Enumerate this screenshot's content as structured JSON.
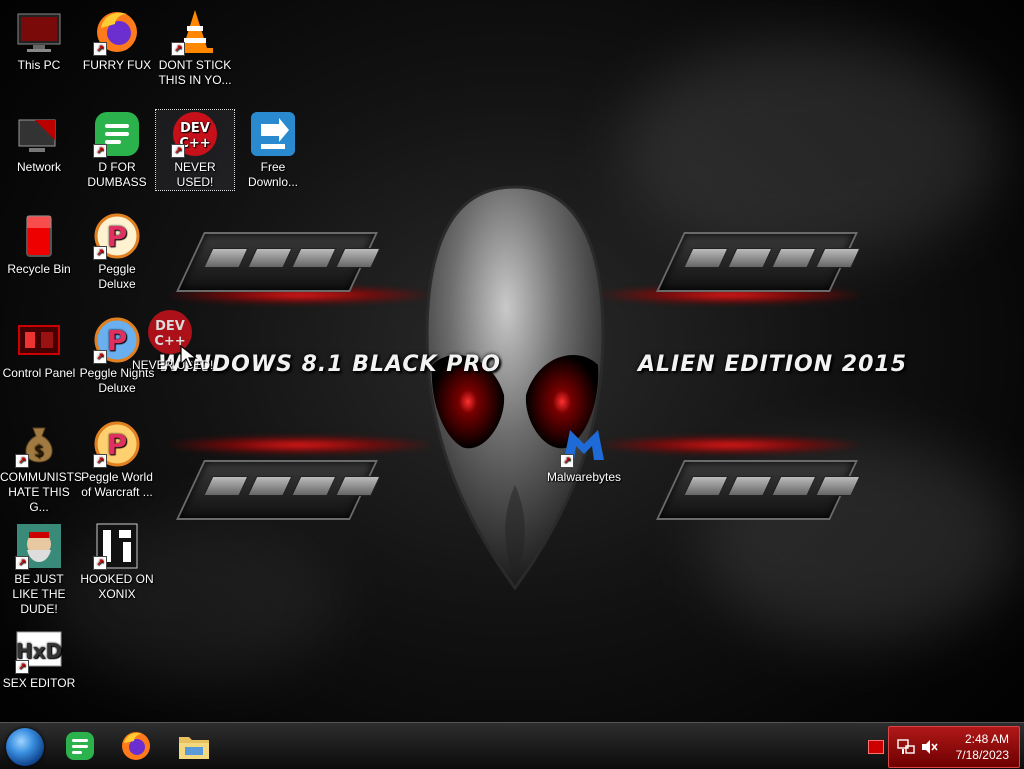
{
  "desktop": {
    "icons": [
      {
        "label": "This PC"
      },
      {
        "label": "FURRY FUX"
      },
      {
        "label": "DONT STICK THIS IN YO..."
      },
      {
        "label": "Network"
      },
      {
        "label": "D FOR DUMBASS"
      },
      {
        "label": "NEVER USED!"
      },
      {
        "label": "Free Downlo..."
      },
      {
        "label": "Recycle Bin"
      },
      {
        "label": "Peggle Deluxe"
      },
      {
        "label": "Control Panel"
      },
      {
        "label": "Peggle Nights Deluxe"
      },
      {
        "label": "COMMUNISTS HATE THIS G..."
      },
      {
        "label": "Peggle World of Warcraft ..."
      },
      {
        "label": "BE JUST LIKE THE DUDE!"
      },
      {
        "label": "HOOKED ON XONIX"
      },
      {
        "label": "SEX EDITOR"
      },
      {
        "label": "Malwarebytes"
      }
    ],
    "dragging_label": "NEVER USED!"
  },
  "wallpaper": {
    "left_text": "WINDOWS 8.1 BLACK PRO",
    "right_text": "ALIEN EDITION 2015"
  },
  "taskbar": {
    "pinned": [
      "start",
      "feedly",
      "firefox",
      "file-explorer"
    ],
    "clock": {
      "time": "2:48 AM",
      "date": "7/18/2023"
    }
  },
  "colors": {
    "accent": "#b01818",
    "tray": "#8a0000"
  }
}
